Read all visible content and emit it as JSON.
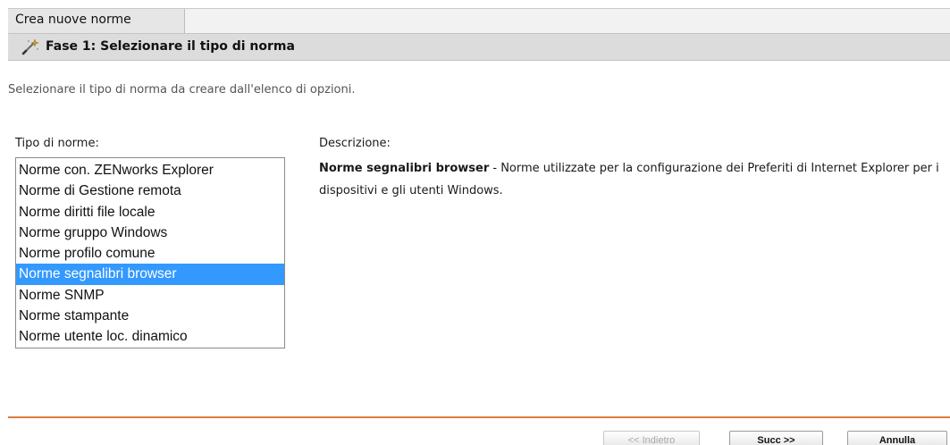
{
  "header": {
    "title": "Crea nuove norme",
    "step_title": "Fase 1: Selezionare il tipo di norma",
    "step_icon": "wand-icon"
  },
  "intro": "Selezionare il tipo di norma da creare dall'elenco di opzioni.",
  "policy_list": {
    "label": "Tipo di norme:",
    "items": [
      "Norme con. ZENworks Explorer",
      "Norme di Gestione remota",
      "Norme diritti file locale",
      "Norme gruppo Windows",
      "Norme profilo comune",
      "Norme segnalibri browser",
      "Norme SNMP",
      "Norme stampante",
      "Norme utente loc. dinamico"
    ],
    "selected": "Norme segnalibri browser"
  },
  "description": {
    "label": "Descrizione:",
    "name": "Norme segnalibri browser",
    "text": " - Norme utilizzate per la configurazione dei Preferiti di Internet Explorer per i dispositivi e gli utenti Windows."
  },
  "buttons": {
    "back": "<< Indietro",
    "next": "Succ >>",
    "cancel": "Annulla"
  },
  "colors": {
    "selection": "#3399ff",
    "divider": "#e07a3a",
    "step_bar": "#dcdcdc"
  }
}
